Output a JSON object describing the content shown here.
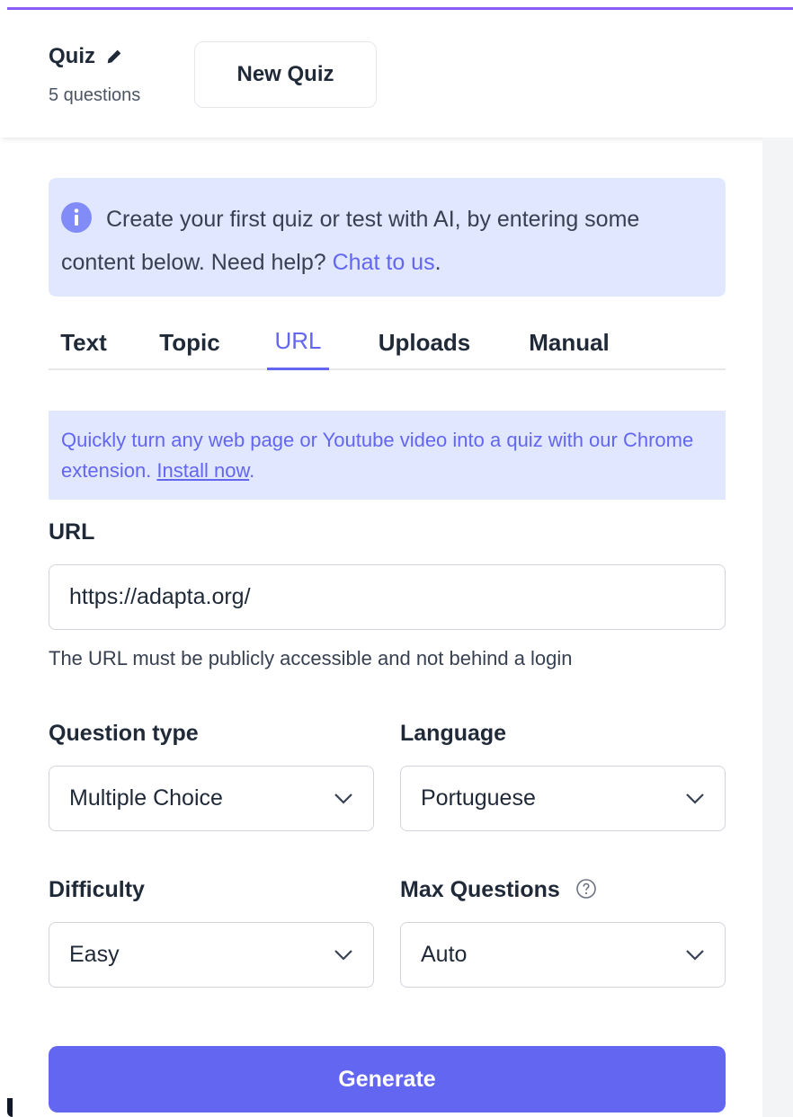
{
  "header": {
    "title": "Quiz",
    "subtitle": "5 questions",
    "new_quiz_label": "New Quiz"
  },
  "info": {
    "text_before": "Create your first quiz or test with AI, by entering some content below. Need help? ",
    "link": "Chat to us",
    "text_after": "."
  },
  "tabs": [
    {
      "label": "Text",
      "active": false
    },
    {
      "label": "Topic",
      "active": false
    },
    {
      "label": "URL",
      "active": true
    },
    {
      "label": "Uploads",
      "active": false
    },
    {
      "label": "Manual",
      "active": false
    }
  ],
  "extension": {
    "text": "Quickly turn any web page or Youtube video into a quiz with our Chrome extension. ",
    "link": "Install now",
    "after": "."
  },
  "url_field": {
    "label": "URL",
    "value": "https://adapta.org/",
    "hint": "The URL must be publicly accessible and not behind a login"
  },
  "question_type": {
    "label": "Question type",
    "value": "Multiple Choice"
  },
  "language": {
    "label": "Language",
    "value": "Portuguese"
  },
  "difficulty": {
    "label": "Difficulty",
    "value": "Easy"
  },
  "max_questions": {
    "label": "Max Questions",
    "value": "Auto"
  },
  "generate_label": "Generate",
  "colors": {
    "accent": "#6366f1",
    "top_bar": "#8b5cf6",
    "info_bg": "#e0e7ff"
  },
  "icons": [
    "pencil-icon",
    "info-icon",
    "chevron-down-icon",
    "help-circle-icon"
  ]
}
